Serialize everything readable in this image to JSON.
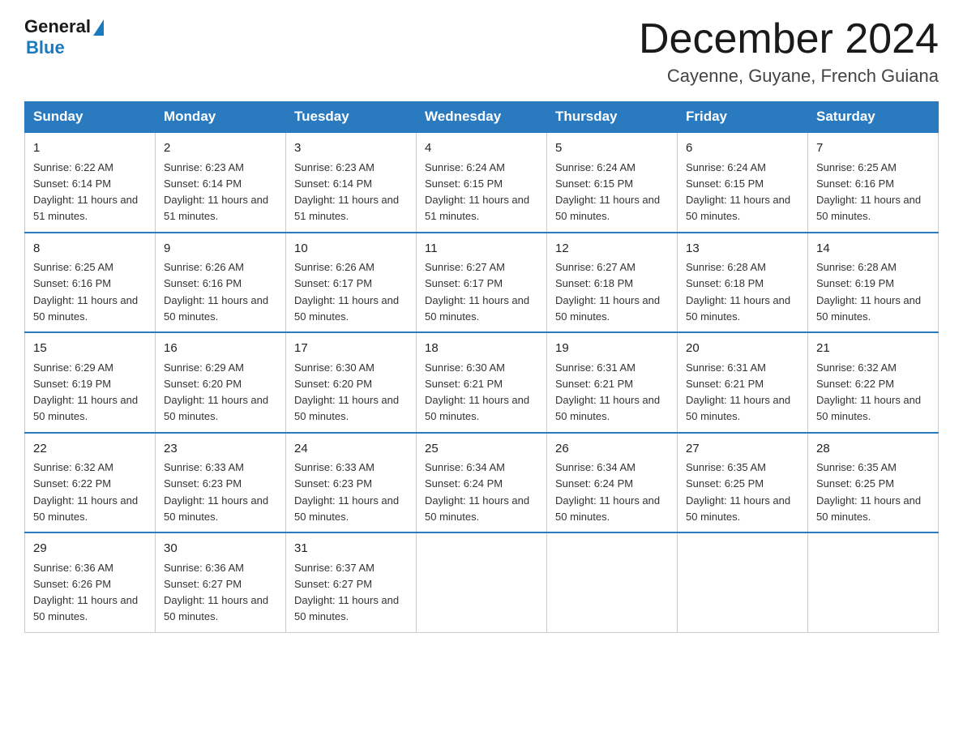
{
  "header": {
    "logo_general": "General",
    "logo_blue": "Blue",
    "main_title": "December 2024",
    "subtitle": "Cayenne, Guyane, French Guiana"
  },
  "days_of_week": [
    "Sunday",
    "Monday",
    "Tuesday",
    "Wednesday",
    "Thursday",
    "Friday",
    "Saturday"
  ],
  "weeks": [
    [
      {
        "day": "1",
        "sunrise": "6:22 AM",
        "sunset": "6:14 PM",
        "daylight": "11 hours and 51 minutes."
      },
      {
        "day": "2",
        "sunrise": "6:23 AM",
        "sunset": "6:14 PM",
        "daylight": "11 hours and 51 minutes."
      },
      {
        "day": "3",
        "sunrise": "6:23 AM",
        "sunset": "6:14 PM",
        "daylight": "11 hours and 51 minutes."
      },
      {
        "day": "4",
        "sunrise": "6:24 AM",
        "sunset": "6:15 PM",
        "daylight": "11 hours and 51 minutes."
      },
      {
        "day": "5",
        "sunrise": "6:24 AM",
        "sunset": "6:15 PM",
        "daylight": "11 hours and 50 minutes."
      },
      {
        "day": "6",
        "sunrise": "6:24 AM",
        "sunset": "6:15 PM",
        "daylight": "11 hours and 50 minutes."
      },
      {
        "day": "7",
        "sunrise": "6:25 AM",
        "sunset": "6:16 PM",
        "daylight": "11 hours and 50 minutes."
      }
    ],
    [
      {
        "day": "8",
        "sunrise": "6:25 AM",
        "sunset": "6:16 PM",
        "daylight": "11 hours and 50 minutes."
      },
      {
        "day": "9",
        "sunrise": "6:26 AM",
        "sunset": "6:16 PM",
        "daylight": "11 hours and 50 minutes."
      },
      {
        "day": "10",
        "sunrise": "6:26 AM",
        "sunset": "6:17 PM",
        "daylight": "11 hours and 50 minutes."
      },
      {
        "day": "11",
        "sunrise": "6:27 AM",
        "sunset": "6:17 PM",
        "daylight": "11 hours and 50 minutes."
      },
      {
        "day": "12",
        "sunrise": "6:27 AM",
        "sunset": "6:18 PM",
        "daylight": "11 hours and 50 minutes."
      },
      {
        "day": "13",
        "sunrise": "6:28 AM",
        "sunset": "6:18 PM",
        "daylight": "11 hours and 50 minutes."
      },
      {
        "day": "14",
        "sunrise": "6:28 AM",
        "sunset": "6:19 PM",
        "daylight": "11 hours and 50 minutes."
      }
    ],
    [
      {
        "day": "15",
        "sunrise": "6:29 AM",
        "sunset": "6:19 PM",
        "daylight": "11 hours and 50 minutes."
      },
      {
        "day": "16",
        "sunrise": "6:29 AM",
        "sunset": "6:20 PM",
        "daylight": "11 hours and 50 minutes."
      },
      {
        "day": "17",
        "sunrise": "6:30 AM",
        "sunset": "6:20 PM",
        "daylight": "11 hours and 50 minutes."
      },
      {
        "day": "18",
        "sunrise": "6:30 AM",
        "sunset": "6:21 PM",
        "daylight": "11 hours and 50 minutes."
      },
      {
        "day": "19",
        "sunrise": "6:31 AM",
        "sunset": "6:21 PM",
        "daylight": "11 hours and 50 minutes."
      },
      {
        "day": "20",
        "sunrise": "6:31 AM",
        "sunset": "6:21 PM",
        "daylight": "11 hours and 50 minutes."
      },
      {
        "day": "21",
        "sunrise": "6:32 AM",
        "sunset": "6:22 PM",
        "daylight": "11 hours and 50 minutes."
      }
    ],
    [
      {
        "day": "22",
        "sunrise": "6:32 AM",
        "sunset": "6:22 PM",
        "daylight": "11 hours and 50 minutes."
      },
      {
        "day": "23",
        "sunrise": "6:33 AM",
        "sunset": "6:23 PM",
        "daylight": "11 hours and 50 minutes."
      },
      {
        "day": "24",
        "sunrise": "6:33 AM",
        "sunset": "6:23 PM",
        "daylight": "11 hours and 50 minutes."
      },
      {
        "day": "25",
        "sunrise": "6:34 AM",
        "sunset": "6:24 PM",
        "daylight": "11 hours and 50 minutes."
      },
      {
        "day": "26",
        "sunrise": "6:34 AM",
        "sunset": "6:24 PM",
        "daylight": "11 hours and 50 minutes."
      },
      {
        "day": "27",
        "sunrise": "6:35 AM",
        "sunset": "6:25 PM",
        "daylight": "11 hours and 50 minutes."
      },
      {
        "day": "28",
        "sunrise": "6:35 AM",
        "sunset": "6:25 PM",
        "daylight": "11 hours and 50 minutes."
      }
    ],
    [
      {
        "day": "29",
        "sunrise": "6:36 AM",
        "sunset": "6:26 PM",
        "daylight": "11 hours and 50 minutes."
      },
      {
        "day": "30",
        "sunrise": "6:36 AM",
        "sunset": "6:27 PM",
        "daylight": "11 hours and 50 minutes."
      },
      {
        "day": "31",
        "sunrise": "6:37 AM",
        "sunset": "6:27 PM",
        "daylight": "11 hours and 50 minutes."
      },
      null,
      null,
      null,
      null
    ]
  ]
}
